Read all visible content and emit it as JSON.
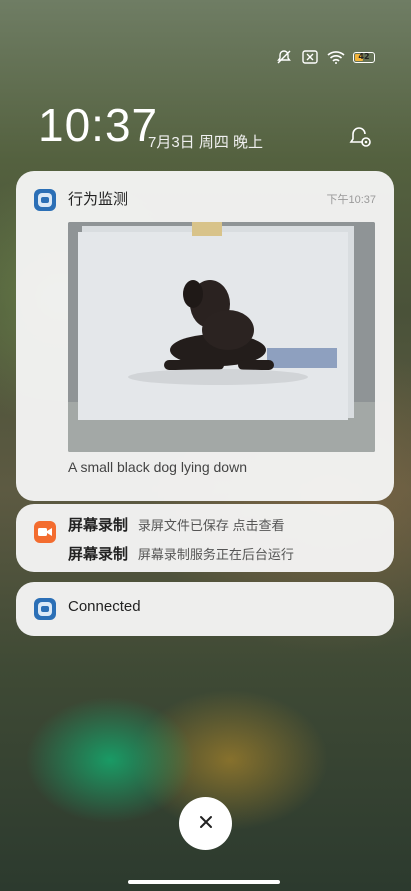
{
  "status_bar": {
    "icons": [
      "bell-muted-icon",
      "no-sim-icon",
      "wifi-icon",
      "battery-icon"
    ],
    "battery_level": "42",
    "battery_color": "#f3b43b"
  },
  "lockscreen": {
    "time": "10:37",
    "date": "7月3日 周四 晚上"
  },
  "notifications": [
    {
      "app": "行为监测",
      "timestamp": "下午10:37",
      "caption": "A small black dog lying down",
      "icon": "app-icon"
    },
    {
      "app": "屏幕录制",
      "lines": [
        {
          "title": "屏幕录制",
          "text": "录屏文件已保存 点击查看"
        },
        {
          "title": "屏幕录制",
          "text": "屏幕录制服务正在后台运行"
        }
      ],
      "icon": "screen-record-icon",
      "accent": "#f36c2f"
    },
    {
      "title": "Connected",
      "icon": "app-icon"
    }
  ],
  "actions": {
    "clear_icon": "close-icon"
  }
}
